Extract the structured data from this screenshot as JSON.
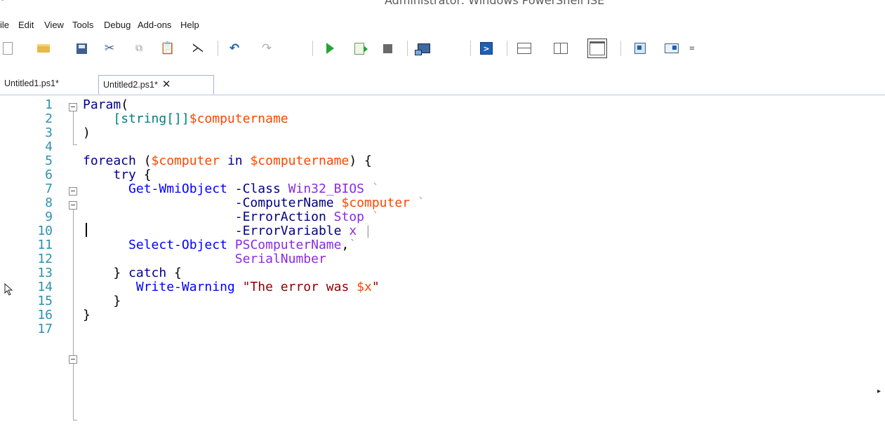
{
  "window": {
    "title": "Administrator: Windows PowerShell ISE"
  },
  "menu": [
    "ile",
    "Edit",
    "View",
    "Tools",
    "Debug",
    "Add-ons",
    "Help"
  ],
  "toolbar": {
    "icons": [
      "new-script-icon",
      "open-icon",
      "save-icon",
      "cut-icon",
      "copy-icon",
      "paste-icon",
      "clear-console-icon",
      "undo-icon",
      "redo-icon",
      "run-script-icon",
      "run-selection-icon",
      "stop-icon",
      "remote-powershell-tab-icon",
      "start-powershell-exe-icon",
      "show-script-pane-top-icon",
      "show-script-pane-right-icon",
      "show-script-pane-maximized-icon",
      "show-command-window-icon",
      "show-command-addon-icon"
    ],
    "overflow": "≡"
  },
  "tabs": [
    {
      "label": "Untitled1.ps1*",
      "active": false
    },
    {
      "label": "Untitled2.ps1*",
      "active": true,
      "close": "✕"
    }
  ],
  "editor": {
    "colors": {
      "line_number": "#2b91af",
      "keyword": "#00008b",
      "cmdlet": "#0000ff",
      "parameter": "#000080",
      "type": "#008080",
      "variable": "#ff4500",
      "string": "#8b0000",
      "argument": "#8a2be2",
      "operator": "#a9a9a9"
    },
    "lines": [
      {
        "n": "1",
        "tokens": [
          [
            "kw",
            "Param"
          ],
          [
            "default",
            "("
          ]
        ]
      },
      {
        "n": "2",
        "tokens": [
          [
            "default",
            "    "
          ],
          [
            "type",
            "[string[]]"
          ],
          [
            "var",
            "$computername"
          ]
        ]
      },
      {
        "n": "3",
        "tokens": [
          [
            "default",
            ")"
          ]
        ]
      },
      {
        "n": "4",
        "tokens": []
      },
      {
        "n": "5",
        "tokens": [
          [
            "kw",
            "foreach"
          ],
          [
            "default",
            " ("
          ],
          [
            "var",
            "$computer"
          ],
          [
            "default",
            " "
          ],
          [
            "kw",
            "in"
          ],
          [
            "default",
            " "
          ],
          [
            "var",
            "$computername"
          ],
          [
            "default",
            ") {"
          ]
        ]
      },
      {
        "n": "6",
        "tokens": [
          [
            "default",
            "    "
          ],
          [
            "kw",
            "try"
          ],
          [
            "default",
            " {"
          ]
        ]
      },
      {
        "n": "7",
        "tokens": [
          [
            "default",
            "      "
          ],
          [
            "cmd",
            "Get-WmiObject"
          ],
          [
            "default",
            " "
          ],
          [
            "param",
            "-Class"
          ],
          [
            "default",
            " "
          ],
          [
            "arg",
            "Win32_BIOS"
          ],
          [
            "default",
            " "
          ],
          [
            "op",
            "`"
          ]
        ]
      },
      {
        "n": "8",
        "tokens": [
          [
            "default",
            "                    "
          ],
          [
            "param",
            "-ComputerName"
          ],
          [
            "default",
            " "
          ],
          [
            "var",
            "$computer"
          ],
          [
            "default",
            " "
          ],
          [
            "op",
            "`"
          ]
        ]
      },
      {
        "n": "9",
        "tokens": [
          [
            "default",
            "                    "
          ],
          [
            "param",
            "-ErrorAction"
          ],
          [
            "default",
            " "
          ],
          [
            "arg",
            "Stop"
          ],
          [
            "default",
            " "
          ],
          [
            "op",
            "`"
          ]
        ]
      },
      {
        "n": "10",
        "tokens": [
          [
            "default",
            "                    "
          ],
          [
            "param",
            "-ErrorVariable"
          ],
          [
            "default",
            " "
          ],
          [
            "arg",
            "x"
          ],
          [
            "default",
            " "
          ],
          [
            "op",
            "|"
          ]
        ]
      },
      {
        "n": "11",
        "tokens": [
          [
            "default",
            "      "
          ],
          [
            "cmd",
            "Select-Object"
          ],
          [
            "default",
            " "
          ],
          [
            "arg",
            "PSComputerName"
          ],
          [
            "default",
            ","
          ],
          [
            "op",
            "`"
          ]
        ]
      },
      {
        "n": "12",
        "tokens": [
          [
            "default",
            "                    "
          ],
          [
            "arg",
            "SerialNumber"
          ]
        ]
      },
      {
        "n": "13",
        "tokens": [
          [
            "default",
            "    } "
          ],
          [
            "kw",
            "catch"
          ],
          [
            "default",
            " {"
          ]
        ]
      },
      {
        "n": "14",
        "tokens": [
          [
            "default",
            "       "
          ],
          [
            "cmd",
            "Write-Warning"
          ],
          [
            "default",
            " "
          ],
          [
            "str",
            "\"The error was "
          ],
          [
            "var",
            "$x"
          ],
          [
            "str",
            "\""
          ]
        ]
      },
      {
        "n": "15",
        "tokens": [
          [
            "default",
            "    }"
          ]
        ]
      },
      {
        "n": "16",
        "tokens": [
          [
            "default",
            "}"
          ]
        ]
      },
      {
        "n": "17",
        "tokens": []
      }
    ]
  }
}
